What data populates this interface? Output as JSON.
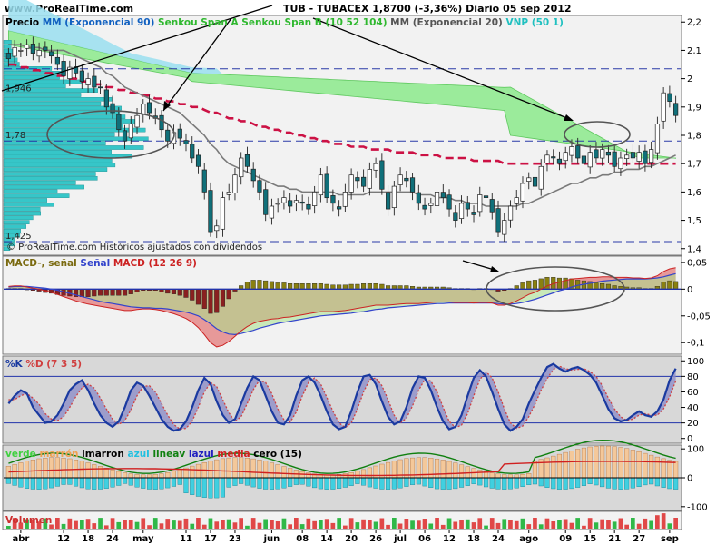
{
  "header": {
    "site": "www.ProRealTime.com",
    "title": "TUB - TUBACEX     1,8700 (-3,36%)     Diario  05 sep 2012"
  },
  "colors": {
    "price_up": "#ffffff",
    "price_down": "#10707a",
    "ema90": "#cc1144",
    "ema20": "#7a7a7a",
    "senkou_a": "#7ee87e",
    "senkou_b": "#9adff0",
    "volume_profile": "#36c6c8",
    "macd": "#e07070",
    "signal": "#3344cc",
    "histogram": "#7a6a10",
    "stoch_k": "#1a3aa0",
    "stoch_d": "#d04040"
  },
  "panels": {
    "price": {
      "legend": [
        {
          "text": "Precio",
          "color": "#000000"
        },
        {
          "text": "MM (Exponencial 90)",
          "color": "#1060c0"
        },
        {
          "text": "Senkou Span A",
          "color": "#2fb82f"
        },
        {
          "text": "Senkou Span B (10 52 104)",
          "color": "#2fb82f"
        },
        {
          "text": "MM (Exponencial 20)",
          "color": "#555555"
        },
        {
          "text": "VNP (50 1)",
          "color": "#20c0c0"
        }
      ],
      "footer": "© ProRealTime.com  Históricos ajustados con dividendos",
      "level_labels": [
        "1,946",
        "1,78",
        "1,425"
      ]
    },
    "macd": {
      "legend": [
        {
          "text": "MACD-, señal",
          "color": "#7a6a10"
        },
        {
          "text": "Señal",
          "color": "#3344cc"
        },
        {
          "text": "MACD (12 26 9)",
          "color": "#cc2222"
        }
      ]
    },
    "stoch": {
      "legend": [
        {
          "text": "%K",
          "color": "#1a3aa0"
        },
        {
          "text": "%D (7 3 5)",
          "color": "#d04040"
        }
      ]
    },
    "ind": {
      "legend": [
        {
          "text": "verde",
          "color": "#40d040"
        },
        {
          "text": "marrón",
          "color": "#f0a050"
        },
        {
          "text": "lmarron",
          "color": "#000000"
        },
        {
          "text": "azul",
          "color": "#20c0e0"
        },
        {
          "text": "lineav",
          "color": "#108010"
        },
        {
          "text": "lazul",
          "color": "#2020c0"
        },
        {
          "text": "media",
          "color": "#d02020"
        },
        {
          "text": "cero (15)",
          "color": "#000000"
        }
      ]
    },
    "volume": {
      "legend": [
        {
          "text": "Volumen",
          "color": "#cc3030"
        }
      ]
    }
  },
  "chart_data": [
    {
      "type": "candlestick",
      "title": "TUB - TUBACEX",
      "y_ticks": [
        "2,2",
        "2,1",
        "2",
        "1,9",
        "1,8",
        "1,7",
        "1,6",
        "1,5",
        "1,4"
      ],
      "ylim": [
        1.38,
        2.22
      ],
      "x_ticks": [
        {
          "label": "abr",
          "i": 2
        },
        {
          "label": "12",
          "i": 9
        },
        {
          "label": "18",
          "i": 13
        },
        {
          "label": "24",
          "i": 17
        },
        {
          "label": "may",
          "i": 22
        },
        {
          "label": "11",
          "i": 29
        },
        {
          "label": "17",
          "i": 33
        },
        {
          "label": "23",
          "i": 37
        },
        {
          "label": "jun",
          "i": 43
        },
        {
          "label": "08",
          "i": 48
        },
        {
          "label": "14",
          "i": 52
        },
        {
          "label": "20",
          "i": 56
        },
        {
          "label": "26",
          "i": 60
        },
        {
          "label": "jul",
          "i": 64
        },
        {
          "label": "06",
          "i": 68
        },
        {
          "label": "12",
          "i": 72
        },
        {
          "label": "18",
          "i": 76
        },
        {
          "label": "24",
          "i": 80
        },
        {
          "label": "ago",
          "i": 85
        },
        {
          "label": "09",
          "i": 91
        },
        {
          "label": "15",
          "i": 95
        },
        {
          "label": "21",
          "i": 99
        },
        {
          "label": "27",
          "i": 103
        },
        {
          "label": "sep",
          "i": 108
        }
      ],
      "close": [
        2.07,
        2.11,
        2.1,
        2.12,
        2.09,
        2.1,
        2.1,
        2.08,
        2.05,
        2.01,
        2.04,
        2.02,
        1.99,
        2.0,
        1.97,
        1.97,
        1.9,
        1.88,
        1.82,
        1.78,
        1.84,
        1.87,
        1.91,
        1.88,
        1.86,
        1.82,
        1.78,
        1.81,
        1.79,
        1.77,
        1.72,
        1.69,
        1.6,
        1.46,
        1.48,
        1.58,
        1.6,
        1.66,
        1.72,
        1.69,
        1.64,
        1.6,
        1.52,
        1.55,
        1.56,
        1.58,
        1.55,
        1.57,
        1.56,
        1.54,
        1.6,
        1.66,
        1.58,
        1.56,
        1.54,
        1.6,
        1.66,
        1.64,
        1.62,
        1.68,
        1.7,
        1.61,
        1.54,
        1.62,
        1.66,
        1.64,
        1.6,
        1.56,
        1.54,
        1.56,
        1.6,
        1.58,
        1.54,
        1.5,
        1.56,
        1.54,
        1.52,
        1.59,
        1.58,
        1.53,
        1.46,
        1.5,
        1.55,
        1.58,
        1.63,
        1.65,
        1.62,
        1.69,
        1.73,
        1.72,
        1.7,
        1.74,
        1.76,
        1.72,
        1.7,
        1.74,
        1.72,
        1.75,
        1.73,
        1.69,
        1.72,
        1.73,
        1.72,
        1.74,
        1.7,
        1.75,
        1.84,
        1.95,
        1.92,
        1.87
      ],
      "ema20": [
        2.12,
        2.12,
        2.12,
        2.11,
        2.11,
        2.11,
        2.1,
        2.1,
        2.1,
        2.1,
        2.09,
        2.08,
        2.07,
        2.06,
        2.05,
        2.04,
        2.02,
        2.01,
        1.99,
        1.97,
        1.96,
        1.95,
        1.94,
        1.93,
        1.92,
        1.91,
        1.9,
        1.89,
        1.88,
        1.86,
        1.84,
        1.82,
        1.8,
        1.77,
        1.75,
        1.72,
        1.7,
        1.69,
        1.68,
        1.67,
        1.66,
        1.65,
        1.64,
        1.63,
        1.62,
        1.62,
        1.61,
        1.61,
        1.6,
        1.6,
        1.6,
        1.6,
        1.6,
        1.6,
        1.59,
        1.59,
        1.59,
        1.59,
        1.59,
        1.6,
        1.6,
        1.6,
        1.6,
        1.6,
        1.6,
        1.6,
        1.6,
        1.59,
        1.59,
        1.59,
        1.58,
        1.58,
        1.58,
        1.57,
        1.57,
        1.56,
        1.56,
        1.56,
        1.55,
        1.55,
        1.55,
        1.55,
        1.55,
        1.55,
        1.56,
        1.56,
        1.57,
        1.58,
        1.59,
        1.6,
        1.61,
        1.62,
        1.63,
        1.63,
        1.64,
        1.65,
        1.65,
        1.66,
        1.66,
        1.67,
        1.67,
        1.68,
        1.68,
        1.68,
        1.69,
        1.69,
        1.7,
        1.71,
        1.72,
        1.73
      ],
      "ema90_dashed": [
        2.05,
        2.05,
        2.04,
        2.04,
        2.03,
        2.03,
        2.02,
        2.02,
        2.01,
        2.01,
        2.0,
        2.0,
        1.99,
        1.99,
        1.98,
        1.98,
        1.97,
        1.97,
        1.96,
        1.96,
        1.95,
        1.95,
        1.94,
        1.94,
        1.93,
        1.93,
        1.92,
        1.92,
        1.91,
        1.91,
        1.9,
        1.9,
        1.89,
        1.88,
        1.88,
        1.87,
        1.86,
        1.86,
        1.85,
        1.85,
        1.84,
        1.83,
        1.83,
        1.82,
        1.82,
        1.81,
        1.81,
        1.8,
        1.8,
        1.79,
        1.79,
        1.78,
        1.78,
        1.77,
        1.77,
        1.77,
        1.76,
        1.76,
        1.76,
        1.75,
        1.75,
        1.75,
        1.75,
        1.74,
        1.74,
        1.74,
        1.74,
        1.73,
        1.73,
        1.73,
        1.73,
        1.72,
        1.72,
        1.72,
        1.72,
        1.72,
        1.71,
        1.71,
        1.71,
        1.71,
        1.71,
        1.7,
        1.7,
        1.7,
        1.7,
        1.7,
        1.7,
        1.7,
        1.7,
        1.7,
        1.7,
        1.7,
        1.7,
        1.7,
        1.7,
        1.7,
        1.7,
        1.7,
        1.7,
        1.7,
        1.7,
        1.7,
        1.7,
        1.7,
        1.7,
        1.7,
        1.7,
        1.7,
        1.7,
        1.7
      ],
      "macd": {
        "y_ticks": [
          "0,05",
          "0",
          "-0,05",
          "-0,1"
        ],
        "ylim": [
          -0.12,
          0.06
        ],
        "macd": [
          0.005,
          0.006,
          0.006,
          0.004,
          0.002,
          0.0,
          -0.003,
          -0.006,
          -0.01,
          -0.014,
          -0.018,
          -0.022,
          -0.025,
          -0.028,
          -0.03,
          -0.032,
          -0.034,
          -0.036,
          -0.038,
          -0.04,
          -0.04,
          -0.038,
          -0.037,
          -0.037,
          -0.038,
          -0.04,
          -0.043,
          -0.046,
          -0.05,
          -0.055,
          -0.062,
          -0.072,
          -0.085,
          -0.1,
          -0.108,
          -0.105,
          -0.098,
          -0.088,
          -0.078,
          -0.07,
          -0.064,
          -0.06,
          -0.058,
          -0.056,
          -0.055,
          -0.053,
          -0.052,
          -0.05,
          -0.048,
          -0.046,
          -0.044,
          -0.042,
          -0.042,
          -0.042,
          -0.041,
          -0.04,
          -0.038,
          -0.036,
          -0.034,
          -0.032,
          -0.03,
          -0.03,
          -0.03,
          -0.029,
          -0.028,
          -0.027,
          -0.027,
          -0.027,
          -0.026,
          -0.025,
          -0.024,
          -0.024,
          -0.024,
          -0.025,
          -0.025,
          -0.025,
          -0.026,
          -0.025,
          -0.025,
          -0.026,
          -0.03,
          -0.03,
          -0.027,
          -0.022,
          -0.016,
          -0.01,
          -0.006,
          0.0,
          0.006,
          0.01,
          0.013,
          0.016,
          0.019,
          0.02,
          0.021,
          0.022,
          0.022,
          0.023,
          0.023,
          0.022,
          0.022,
          0.022,
          0.021,
          0.021,
          0.02,
          0.021,
          0.025,
          0.033,
          0.038,
          0.04
        ],
        "signal": [
          0.004,
          0.005,
          0.005,
          0.005,
          0.004,
          0.003,
          0.002,
          0.0,
          -0.002,
          -0.005,
          -0.008,
          -0.011,
          -0.014,
          -0.017,
          -0.02,
          -0.023,
          -0.025,
          -0.027,
          -0.029,
          -0.031,
          -0.033,
          -0.034,
          -0.035,
          -0.035,
          -0.036,
          -0.036,
          -0.037,
          -0.039,
          -0.041,
          -0.043,
          -0.046,
          -0.05,
          -0.057,
          -0.065,
          -0.074,
          -0.08,
          -0.084,
          -0.085,
          -0.083,
          -0.08,
          -0.077,
          -0.073,
          -0.07,
          -0.067,
          -0.064,
          -0.062,
          -0.06,
          -0.058,
          -0.056,
          -0.054,
          -0.052,
          -0.05,
          -0.049,
          -0.048,
          -0.047,
          -0.046,
          -0.045,
          -0.043,
          -0.042,
          -0.04,
          -0.038,
          -0.037,
          -0.035,
          -0.034,
          -0.033,
          -0.032,
          -0.031,
          -0.03,
          -0.029,
          -0.028,
          -0.027,
          -0.027,
          -0.026,
          -0.026,
          -0.026,
          -0.026,
          -0.026,
          -0.026,
          -0.026,
          -0.026,
          -0.027,
          -0.028,
          -0.028,
          -0.027,
          -0.025,
          -0.022,
          -0.019,
          -0.015,
          -0.011,
          -0.007,
          -0.003,
          0.0,
          0.004,
          0.007,
          0.009,
          0.011,
          0.013,
          0.015,
          0.016,
          0.017,
          0.018,
          0.019,
          0.019,
          0.019,
          0.019,
          0.02,
          0.021,
          0.023,
          0.026,
          0.029
        ]
      },
      "stoch": {
        "y_ticks": [
          "100",
          "80",
          "60",
          "40",
          "20",
          "0"
        ],
        "ylim": [
          -5,
          105
        ],
        "k": [
          45,
          55,
          62,
          58,
          40,
          30,
          20,
          22,
          30,
          45,
          62,
          70,
          75,
          62,
          45,
          30,
          20,
          15,
          22,
          40,
          62,
          72,
          68,
          55,
          40,
          25,
          15,
          10,
          12,
          22,
          40,
          62,
          78,
          70,
          48,
          30,
          20,
          25,
          45,
          65,
          80,
          75,
          55,
          35,
          20,
          18,
          30,
          55,
          75,
          80,
          72,
          55,
          35,
          18,
          12,
          15,
          35,
          60,
          80,
          82,
          70,
          48,
          28,
          18,
          22,
          40,
          65,
          80,
          78,
          62,
          40,
          22,
          12,
          15,
          30,
          55,
          78,
          88,
          80,
          60,
          38,
          18,
          10,
          15,
          25,
          45,
          62,
          78,
          92,
          96,
          90,
          86,
          90,
          92,
          88,
          82,
          72,
          55,
          38,
          26,
          22,
          24,
          30,
          35,
          30,
          28,
          35,
          50,
          75,
          90
        ],
        "d": [
          50,
          50,
          55,
          58,
          52,
          44,
          32,
          25,
          23,
          28,
          40,
          54,
          65,
          70,
          65,
          52,
          38,
          25,
          18,
          23,
          37,
          55,
          67,
          68,
          60,
          45,
          30,
          18,
          12,
          13,
          22,
          40,
          60,
          72,
          67,
          50,
          33,
          22,
          28,
          45,
          63,
          75,
          72,
          58,
          38,
          24,
          21,
          34,
          55,
          72,
          78,
          70,
          53,
          35,
          20,
          14,
          20,
          38,
          60,
          76,
          78,
          68,
          50,
          30,
          20,
          26,
          42,
          62,
          76,
          74,
          60,
          40,
          22,
          14,
          17,
          32,
          55,
          76,
          86,
          78,
          60,
          38,
          20,
          13,
          16,
          28,
          44,
          62,
          77,
          89,
          93,
          90,
          88,
          89,
          90,
          86,
          80,
          68,
          52,
          38,
          28,
          23,
          25,
          30,
          32,
          30,
          30,
          38,
          54,
          74
        ]
      },
      "indicator": {
        "y_ticks": [
          "100",
          "0",
          "-100"
        ],
        "ylim": [
          -110,
          110
        ],
        "cero_value": 0
      },
      "volume": {
        "label": "Volumen"
      }
    }
  ]
}
